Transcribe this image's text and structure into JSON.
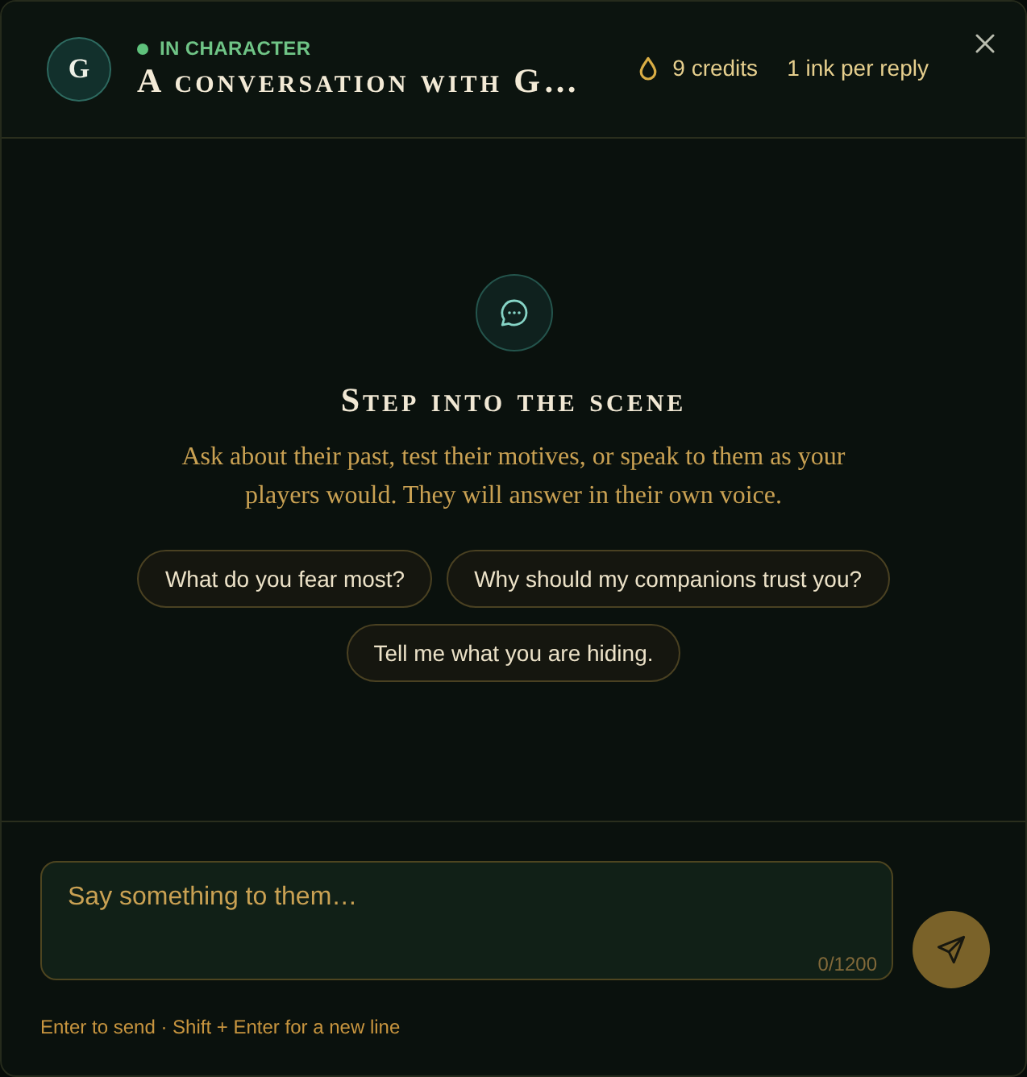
{
  "header": {
    "avatar_initial": "G",
    "status": {
      "label": "IN CHARACTER",
      "online": true
    },
    "title": "A conversation with G…",
    "credits": "9 credits",
    "cost": "1 ink per reply"
  },
  "empty_state": {
    "heading": "Step into the scene",
    "description": "Ask about their past, test their motives, or speak to them as your players would. They will answer in their own voice.",
    "suggestions": [
      "What do you fear most?",
      "Why should my companions trust you?",
      "Tell me what you are hiding."
    ]
  },
  "composer": {
    "placeholder": "Say something to them…",
    "counter": "0/1200",
    "hint": "Enter to send · Shift + Enter for a new line"
  }
}
